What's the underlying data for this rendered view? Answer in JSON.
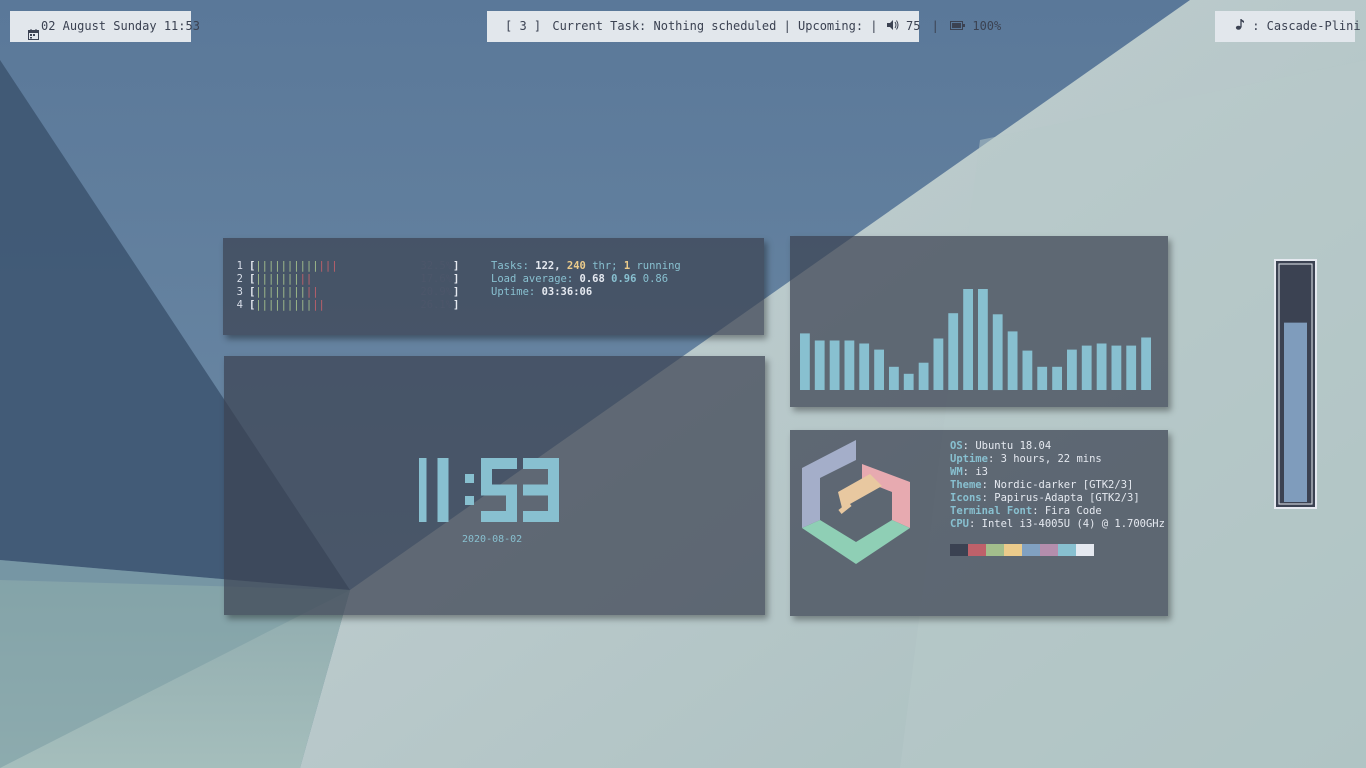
{
  "topbar": {
    "left": {
      "icon": "calendar-icon",
      "text": "02 August Sunday 11:53"
    },
    "center": {
      "workspace": "[ 3 ]",
      "task": "Current Task: Nothing scheduled",
      "upcoming": "Upcoming: |",
      "volume_icon": "volume-icon",
      "volume": "75",
      "separator": "|",
      "battery_icon": "battery-icon",
      "battery": "100%"
    },
    "right": {
      "icon": "music-note-icon",
      "text": ": Cascade-Plini"
    }
  },
  "htop": {
    "cpus": [
      {
        "id": "1",
        "green": "||||||||||",
        "red": "|||",
        "pct": "32.5%"
      },
      {
        "id": "2",
        "green": "|||||||",
        "red": "||",
        "pct": "17.6%"
      },
      {
        "id": "3",
        "green": "||||||||",
        "red": "||",
        "pct": "20.9%"
      },
      {
        "id": "4",
        "green": "|||||||||",
        "red": "||",
        "pct": "26.1%"
      }
    ],
    "bracket_open": "[",
    "bracket_close": "]",
    "tasks_label": "Tasks:",
    "tasks": "122,",
    "threads": "240",
    "threads_suffix": "thr;",
    "running": "1",
    "running_label": "running",
    "load_label": "Load average:",
    "load1": "0.68",
    "load5": "0.96",
    "load15": "0.86",
    "uptime_label": "Uptime:",
    "uptime": "03:36:06"
  },
  "clock": {
    "time": "11:53",
    "date": "2020-08-02"
  },
  "visualizer": {
    "bars": [
      0.56,
      0.49,
      0.49,
      0.49,
      0.46,
      0.4,
      0.23,
      0.16,
      0.27,
      0.51,
      0.76,
      1.0,
      1.0,
      0.75,
      0.58,
      0.39,
      0.23,
      0.23,
      0.4,
      0.44,
      0.46,
      0.44,
      0.44,
      0.52
    ],
    "color": "#88c0d0"
  },
  "neofetch": {
    "logo_icon": "pop-os-style-logo-icon",
    "lines": [
      {
        "key": "OS",
        "value": "Ubuntu 18.04"
      },
      {
        "key": "Uptime",
        "value": "3 hours, 22 mins"
      },
      {
        "key": "WM",
        "value": "i3"
      },
      {
        "key": "Theme",
        "value": "Nordic-darker [GTK2/3]"
      },
      {
        "key": "Icons",
        "value": "Papirus-Adapta [GTK2/3]"
      },
      {
        "key": "Terminal Font",
        "value": "Fira Code"
      },
      {
        "key": "CPU",
        "value": "Intel i3-4005U (4) @ 1.700GHz"
      }
    ],
    "palette": [
      "#3b4252",
      "#bf616a",
      "#a3be8c",
      "#ebcb8b",
      "#81a1c1",
      "#b48ead",
      "#88c0d0",
      "#e5e9f0"
    ]
  },
  "gauge": {
    "level": 0.76,
    "fill": "#7f9cbc",
    "empty": "#3b4252"
  }
}
